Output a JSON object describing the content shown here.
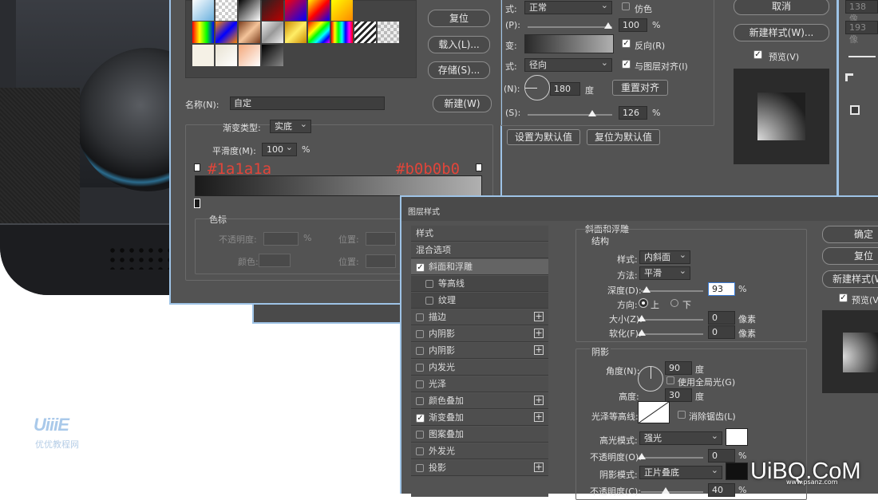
{
  "gradient_editor": {
    "buttons": {
      "reset": "复位",
      "load": "载入(L)...",
      "save": "存储(S)...",
      "new": "新建(W)"
    },
    "name_label": "名称(N):",
    "name_value": "自定",
    "type_label": "渐变类型:",
    "type_value": "实底",
    "smooth_label": "平滑度(M):",
    "smooth_value": "100",
    "smooth_unit": "%",
    "stop_left_hex": "#1a1a1a",
    "stop_right_hex": "#b0b0b0",
    "stops_group_title": "色标",
    "opacity_label": "不透明度:",
    "opacity_unit": "%",
    "position_label": "位置:",
    "color_label": "颜色:",
    "position_label2": "位置:"
  },
  "gradient_overlay_panel": {
    "blend_label": "式:",
    "blend_value": "正常",
    "dither_label": "仿色",
    "opacity_label": "(P):",
    "opacity_value": "100",
    "opacity_unit": "%",
    "gradient_label": "变:",
    "reverse_label": "反向(R)",
    "style_label": "式:",
    "style_value": "径向",
    "align_label": "与图层对齐(I)",
    "angle_label": "(N):",
    "angle_value": "180",
    "angle_unit": "度",
    "reset_align": "重置对齐",
    "scale_label": "(S):",
    "scale_value": "126",
    "scale_unit": "%",
    "set_default": "设置为默认值",
    "reset_default": "复位为默认值"
  },
  "right_panel_top": {
    "cancel": "取消",
    "new_style": "新建样式(W)...",
    "preview": "预览(V)",
    "side_nums": [
      "138 像",
      "193 像"
    ]
  },
  "layer_style": {
    "title": "图层样式",
    "styles_header": "样式",
    "blend_options": "混合选项",
    "items": [
      {
        "label": "斜面和浮雕",
        "checked": true,
        "plus": false,
        "sub": false,
        "active": true
      },
      {
        "label": "等高线",
        "checked": false,
        "plus": false,
        "sub": true,
        "active": false
      },
      {
        "label": "纹理",
        "checked": false,
        "plus": false,
        "sub": true,
        "active": false
      },
      {
        "label": "描边",
        "checked": false,
        "plus": true,
        "sub": false,
        "active": false
      },
      {
        "label": "内阴影",
        "checked": false,
        "plus": true,
        "sub": false,
        "active": false
      },
      {
        "label": "内阴影",
        "checked": false,
        "plus": true,
        "sub": false,
        "active": false
      },
      {
        "label": "内发光",
        "checked": false,
        "plus": false,
        "sub": false,
        "active": false
      },
      {
        "label": "光泽",
        "checked": false,
        "plus": false,
        "sub": false,
        "active": false
      },
      {
        "label": "颜色叠加",
        "checked": false,
        "plus": true,
        "sub": false,
        "active": false
      },
      {
        "label": "渐变叠加",
        "checked": true,
        "plus": true,
        "sub": false,
        "active": false
      },
      {
        "label": "图案叠加",
        "checked": false,
        "plus": false,
        "sub": false,
        "active": false
      },
      {
        "label": "外发光",
        "checked": false,
        "plus": false,
        "sub": false,
        "active": false
      },
      {
        "label": "投影",
        "checked": false,
        "plus": true,
        "sub": false,
        "active": false
      }
    ],
    "bevel": {
      "section_title": "斜面和浮雕",
      "structure": "结构",
      "style_label": "样式:",
      "style_value": "内斜面",
      "technique_label": "方法:",
      "technique_value": "平滑",
      "depth_label": "深度(D):",
      "depth_value": "93",
      "depth_unit": "%",
      "direction_label": "方向:",
      "dir_up": "上",
      "dir_down": "下",
      "size_label": "大小(Z):",
      "size_value": "0",
      "size_unit": "像素",
      "soften_label": "软化(F):",
      "soften_value": "0",
      "soften_unit": "像素"
    },
    "shading": {
      "title": "阴影",
      "angle_label": "角度(N):",
      "angle_value": "90",
      "angle_unit": "度",
      "global_light": "使用全局光(G)",
      "altitude_label": "高度:",
      "altitude_value": "30",
      "altitude_unit": "度",
      "gloss_label": "光泽等高线:",
      "anti_alias": "消除锯齿(L)",
      "highlight_label": "高光模式:",
      "highlight_value": "强光",
      "hl_opacity_label": "不透明度(O):",
      "hl_opacity_value": "0",
      "hl_opacity_unit": "%",
      "shadow_label": "阴影模式:",
      "shadow_value": "正片叠底",
      "sh_opacity_label": "不透明度(C):",
      "sh_opacity_value": "40",
      "sh_opacity_unit": "%"
    },
    "buttons": {
      "ok": "确定",
      "reset": "复位",
      "new_style": "新建样式(W",
      "preview": "预览(V"
    }
  },
  "watermarks": {
    "left_logo": "UiiiE",
    "left_sub": "优优教程网",
    "right_logo": "UiBQ.CoM",
    "right_sub": "www.psanz.com"
  },
  "colors": {
    "stop_text": "#e0453a",
    "panel": "#535353",
    "dark": "#3a3a3a",
    "accent_border": "#9ec3e6"
  }
}
